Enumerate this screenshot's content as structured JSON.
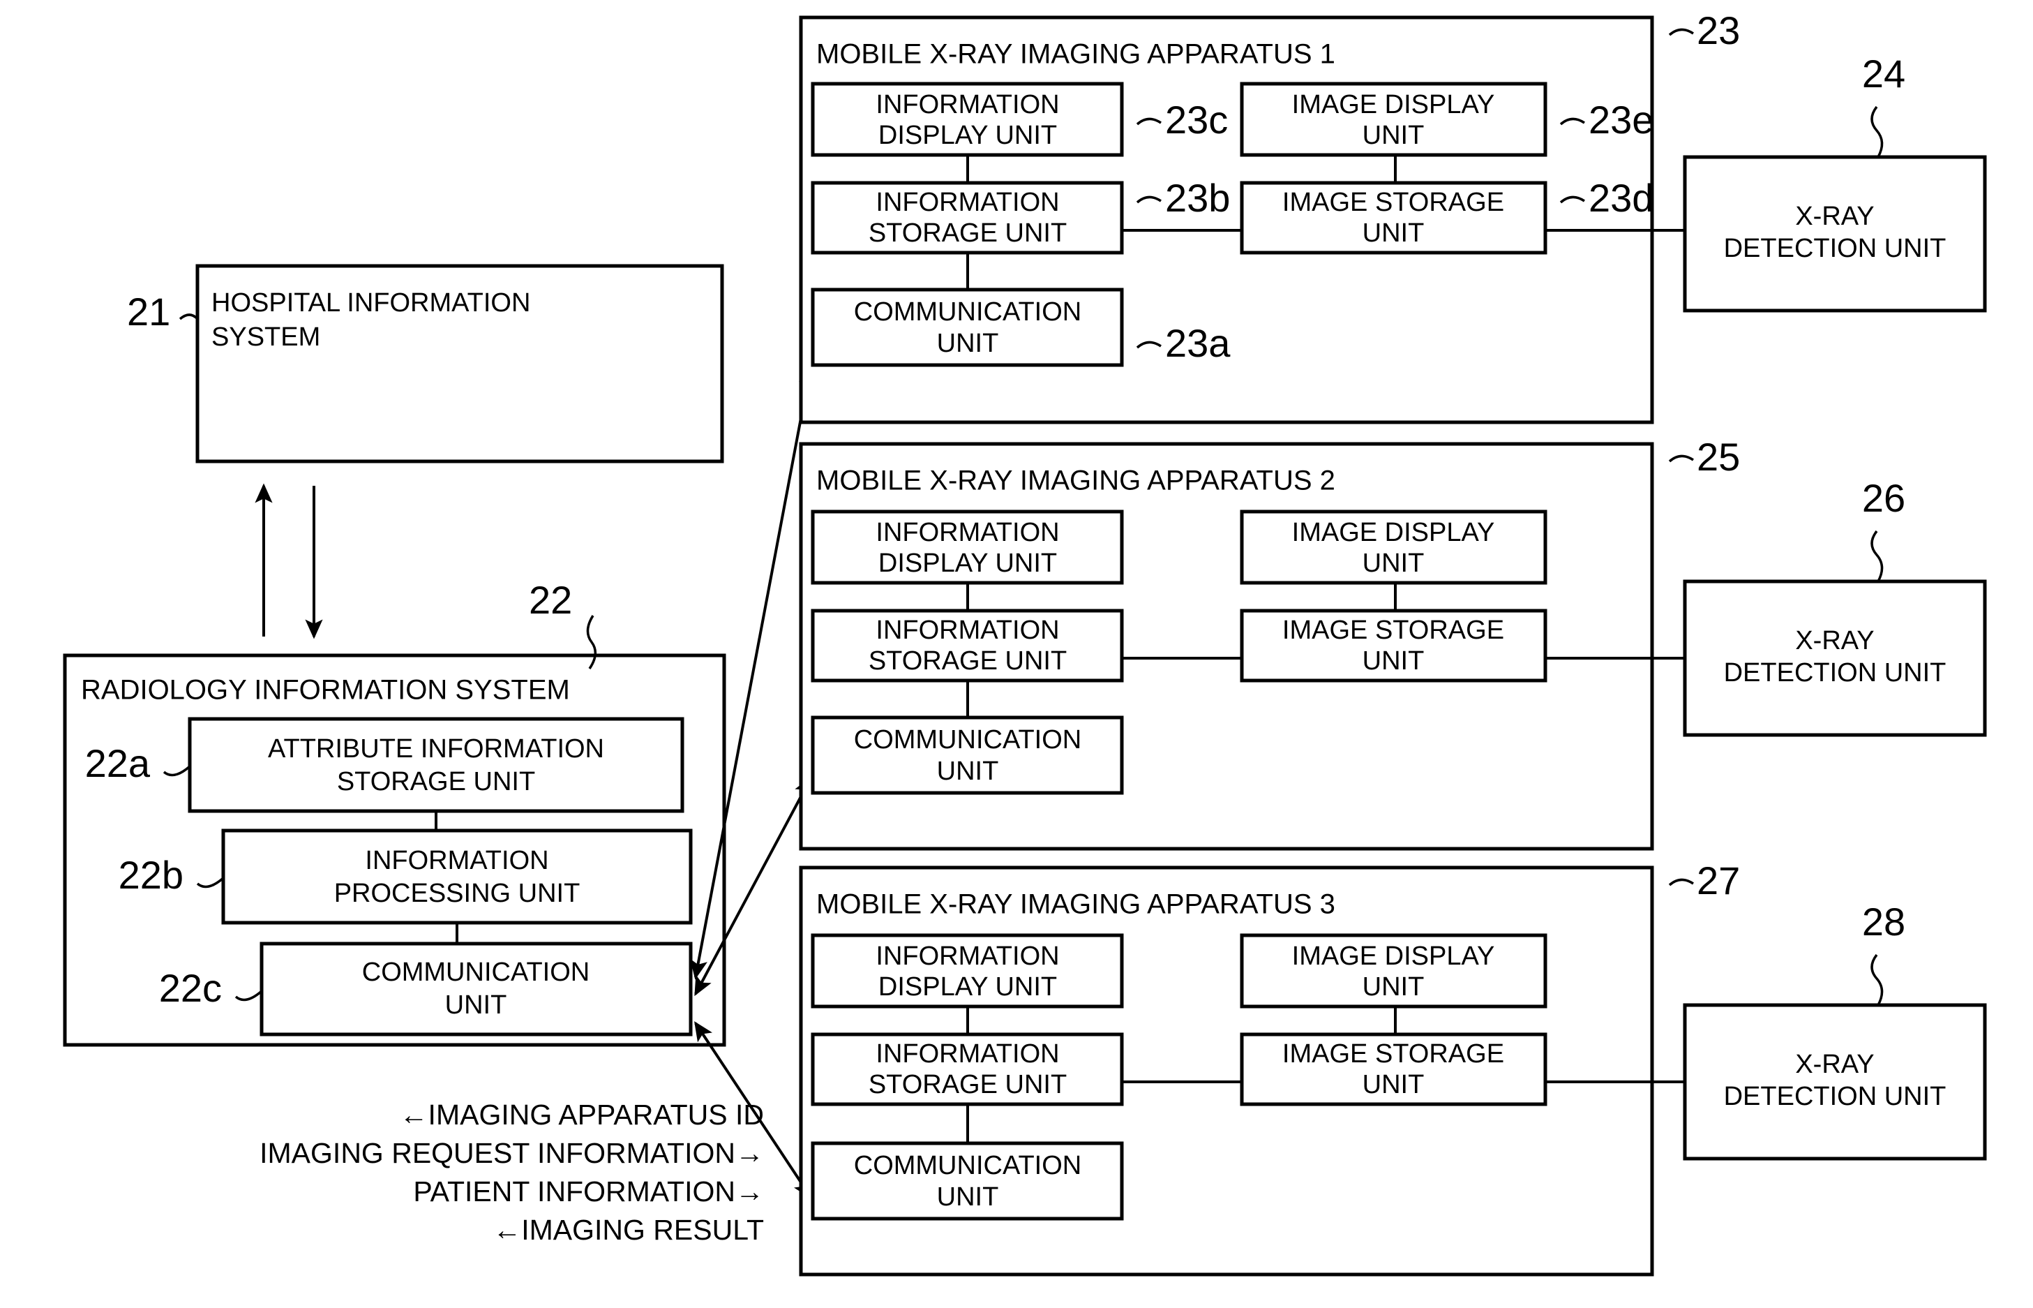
{
  "figure": {
    "type": "patent-block-diagram",
    "background": "#ffffff",
    "stroke": "#000000"
  },
  "hospital_information_system": {
    "label": "HOSPITAL INFORMATION\nSYSTEM",
    "line1": "HOSPITAL INFORMATION",
    "line2": "SYSTEM",
    "ref": "21"
  },
  "radiology_information_system": {
    "title": "RADIOLOGY INFORMATION SYSTEM",
    "ref": "22",
    "units": [
      {
        "line1": "ATTRIBUTE INFORMATION",
        "line2": "STORAGE UNIT",
        "ref": "22a"
      },
      {
        "line1": "INFORMATION",
        "line2": "PROCESSING UNIT",
        "ref": "22b"
      },
      {
        "line1": "COMMUNICATION",
        "line2": "UNIT",
        "ref": "22c"
      }
    ]
  },
  "legend": {
    "lines": [
      "←IMAGING APPARATUS ID",
      "IMAGING REQUEST INFORMATION→",
      "PATIENT INFORMATION→",
      "←IMAGING RESULT"
    ]
  },
  "apparatuses": [
    {
      "title": "MOBILE X-RAY IMAGING APPARATUS 1",
      "ref": "23",
      "units": [
        {
          "line1": "INFORMATION",
          "line2": "DISPLAY UNIT",
          "ref": "23c"
        },
        {
          "line1": "IMAGE DISPLAY",
          "line2": "UNIT",
          "ref": "23e"
        },
        {
          "line1": "INFORMATION",
          "line2": "STORAGE UNIT",
          "ref": "23b"
        },
        {
          "line1": "IMAGE STORAGE",
          "line2": "UNIT",
          "ref": "23d"
        },
        {
          "line1": "COMMUNICATION",
          "line2": "UNIT",
          "ref": "23a"
        }
      ],
      "detector": {
        "line1": "X-RAY",
        "line2": "DETECTION UNIT",
        "ref": "24"
      }
    },
    {
      "title": "MOBILE X-RAY IMAGING APPARATUS 2",
      "ref": "25",
      "units": [
        {
          "line1": "INFORMATION",
          "line2": "DISPLAY UNIT",
          "ref": ""
        },
        {
          "line1": "IMAGE DISPLAY",
          "line2": "UNIT",
          "ref": ""
        },
        {
          "line1": "INFORMATION",
          "line2": "STORAGE UNIT",
          "ref": ""
        },
        {
          "line1": "IMAGE STORAGE",
          "line2": "UNIT",
          "ref": ""
        },
        {
          "line1": "COMMUNICATION",
          "line2": "UNIT",
          "ref": ""
        }
      ],
      "detector": {
        "line1": "X-RAY",
        "line2": "DETECTION UNIT",
        "ref": "26"
      }
    },
    {
      "title": "MOBILE X-RAY IMAGING APPARATUS 3",
      "ref": "27",
      "units": [
        {
          "line1": "INFORMATION",
          "line2": "DISPLAY UNIT",
          "ref": ""
        },
        {
          "line1": "IMAGE DISPLAY",
          "line2": "UNIT",
          "ref": ""
        },
        {
          "line1": "INFORMATION",
          "line2": "STORAGE UNIT",
          "ref": ""
        },
        {
          "line1": "IMAGE STORAGE",
          "line2": "UNIT",
          "ref": ""
        },
        {
          "line1": "COMMUNICATION",
          "line2": "UNIT",
          "ref": ""
        }
      ],
      "detector": {
        "line1": "X-RAY",
        "line2": "DETECTION UNIT",
        "ref": "28"
      }
    }
  ]
}
